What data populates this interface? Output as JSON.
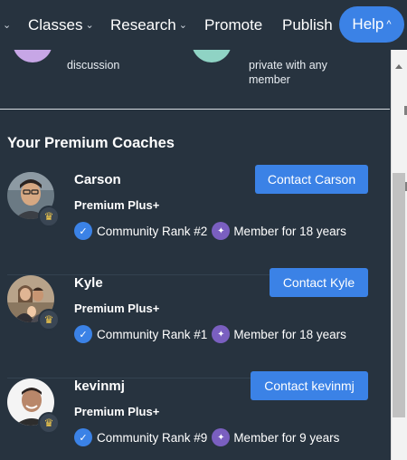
{
  "nav": {
    "items": [
      {
        "label": "Classes",
        "has_dropdown": true
      },
      {
        "label": "Research",
        "has_dropdown": true
      },
      {
        "label": "Promote",
        "has_dropdown": false
      },
      {
        "label": "Publish",
        "has_dropdown": false
      }
    ],
    "help": {
      "label": "Help",
      "active": true
    },
    "chevron_down": "⌄",
    "chevron_up": "^"
  },
  "partial_row": {
    "left_text": "discussion",
    "right_text": "private with any member"
  },
  "section_title": "Your Premium Coaches",
  "coaches": [
    {
      "name": "Carson",
      "tier": "Premium Plus+",
      "rank": "Community Rank #2",
      "member_for": "Member for 18 years",
      "contact_label": "Contact Carson"
    },
    {
      "name": "Kyle",
      "tier": "Premium Plus+",
      "rank": "Community Rank #1",
      "member_for": "Member for 18 years",
      "contact_label": "Contact Kyle"
    },
    {
      "name": "kevinmj",
      "tier": "Premium Plus+",
      "rank": "Community Rank #9",
      "member_for": "Member for 9 years",
      "contact_label": "Contact kevinmj"
    }
  ],
  "icons": {
    "crown": "crown-icon",
    "rank": "check-badge-icon",
    "member": "member-badge-icon"
  },
  "colors": {
    "background": "#27333f",
    "accent": "#3b82e6",
    "crown": "#f2c94c",
    "member_badge": "#7a5fc0"
  }
}
